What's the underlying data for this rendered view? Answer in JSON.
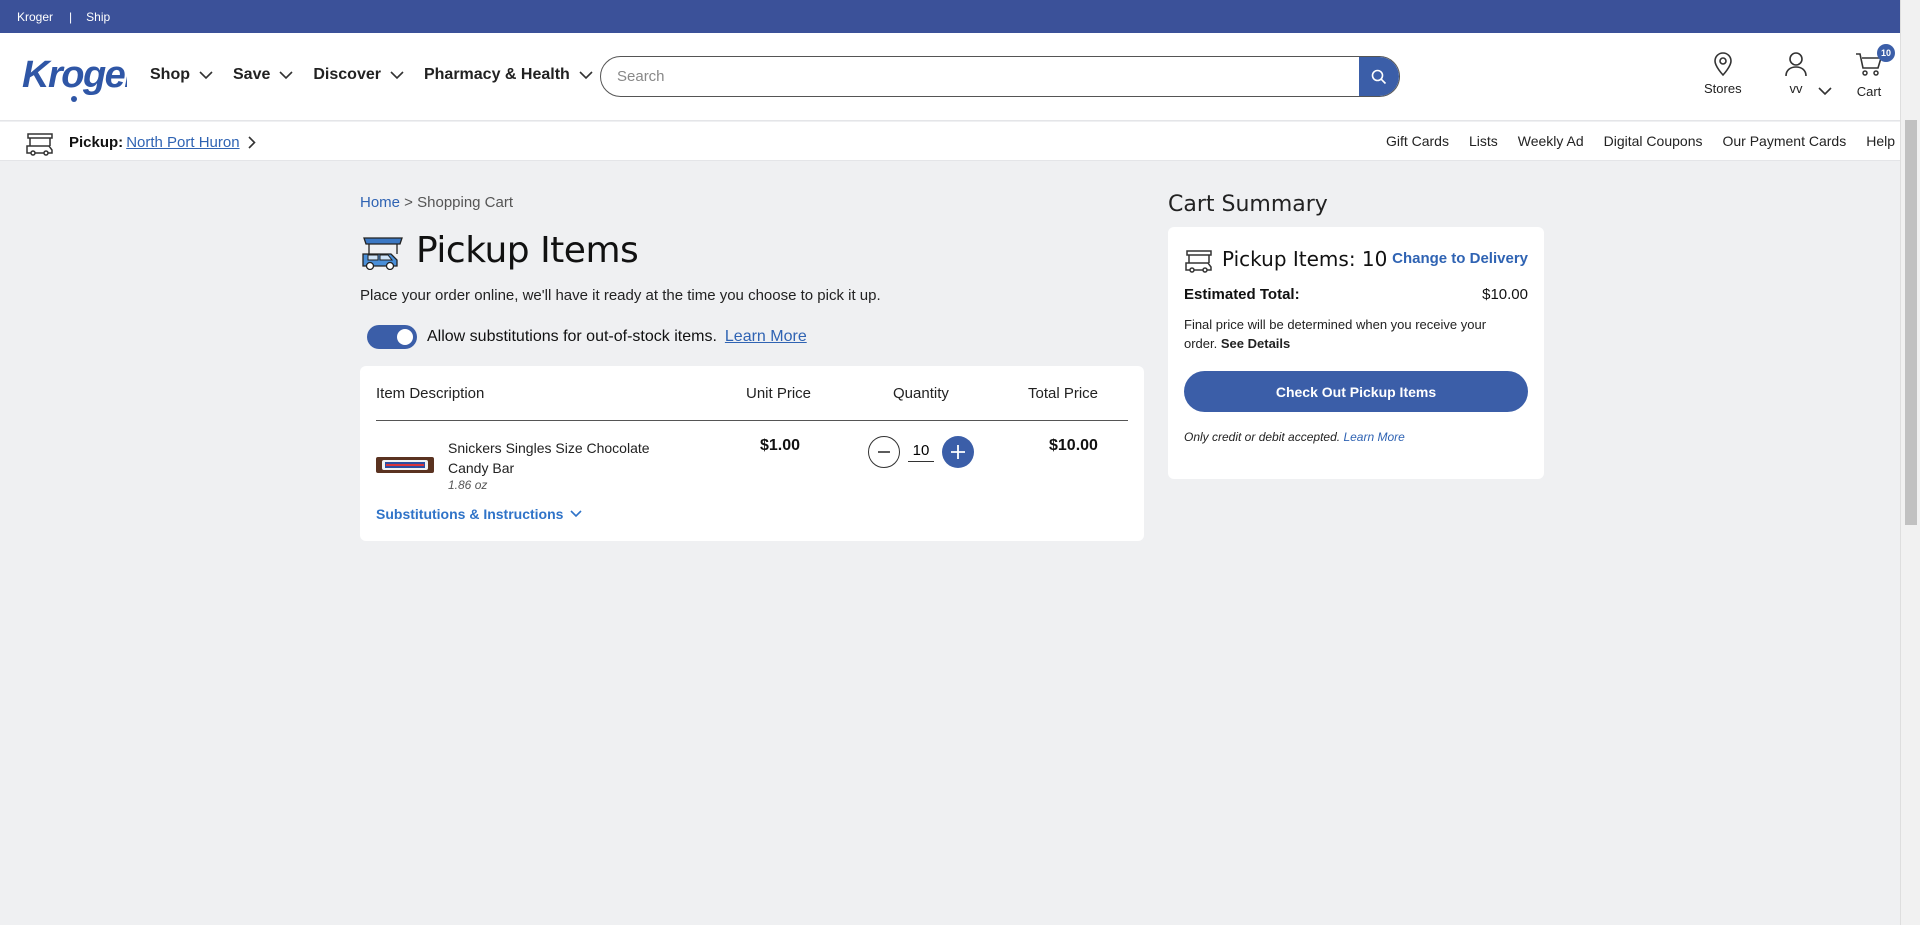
{
  "topstrip": {
    "link1": "Kroger",
    "sep": "|",
    "link2": "Ship"
  },
  "header": {
    "nav": [
      {
        "label": "Shop"
      },
      {
        "label": "Save"
      },
      {
        "label": "Discover"
      },
      {
        "label": "Pharmacy & Health"
      }
    ],
    "search_placeholder": "Search",
    "stores_label": "Stores",
    "account_label": "vv",
    "cart_label": "Cart",
    "cart_count": "10"
  },
  "subheader": {
    "pickup_label": "Pickup:",
    "store_name": "North Port Huron",
    "links": [
      "Gift Cards",
      "Lists",
      "Weekly Ad",
      "Digital Coupons",
      "Our Payment Cards",
      "Help"
    ]
  },
  "breadcrumb": {
    "home": "Home",
    "sep": " > ",
    "current": "Shopping Cart"
  },
  "page": {
    "title": "Pickup Items",
    "subtitle": "Place your order online, we'll have it ready at the time you choose to pick it up.",
    "substitution_text": "Allow substitutions for out-of-stock items.",
    "substitution_learn": "Learn More",
    "substitutions_enabled": true
  },
  "cart": {
    "headers": {
      "desc": "Item Description",
      "unit": "Unit Price",
      "qty": "Quantity",
      "total": "Total Price"
    },
    "item": {
      "name": "Snickers Singles Size Chocolate Candy Bar",
      "size": "1.86 oz",
      "unit_price": "$1.00",
      "quantity": "10",
      "total_price": "$10.00",
      "subs_label": "Substitutions & Instructions"
    }
  },
  "summary": {
    "title": "Cart Summary",
    "items_label": "Pickup Items: 10",
    "change_label": "Change to Delivery",
    "est_label": "Estimated Total:",
    "est_value": "$10.00",
    "final_note": "Final price will be determined when you receive your order.",
    "see_details": "See Details",
    "checkout_label": "Check Out Pickup Items",
    "pay_note": "Only credit or debit accepted.",
    "pay_learn": "Learn More"
  },
  "colors": {
    "brand_blue": "#3b5ea8",
    "top_strip": "#3b5199",
    "link": "#2f63b3",
    "background": "#eff0f2"
  }
}
